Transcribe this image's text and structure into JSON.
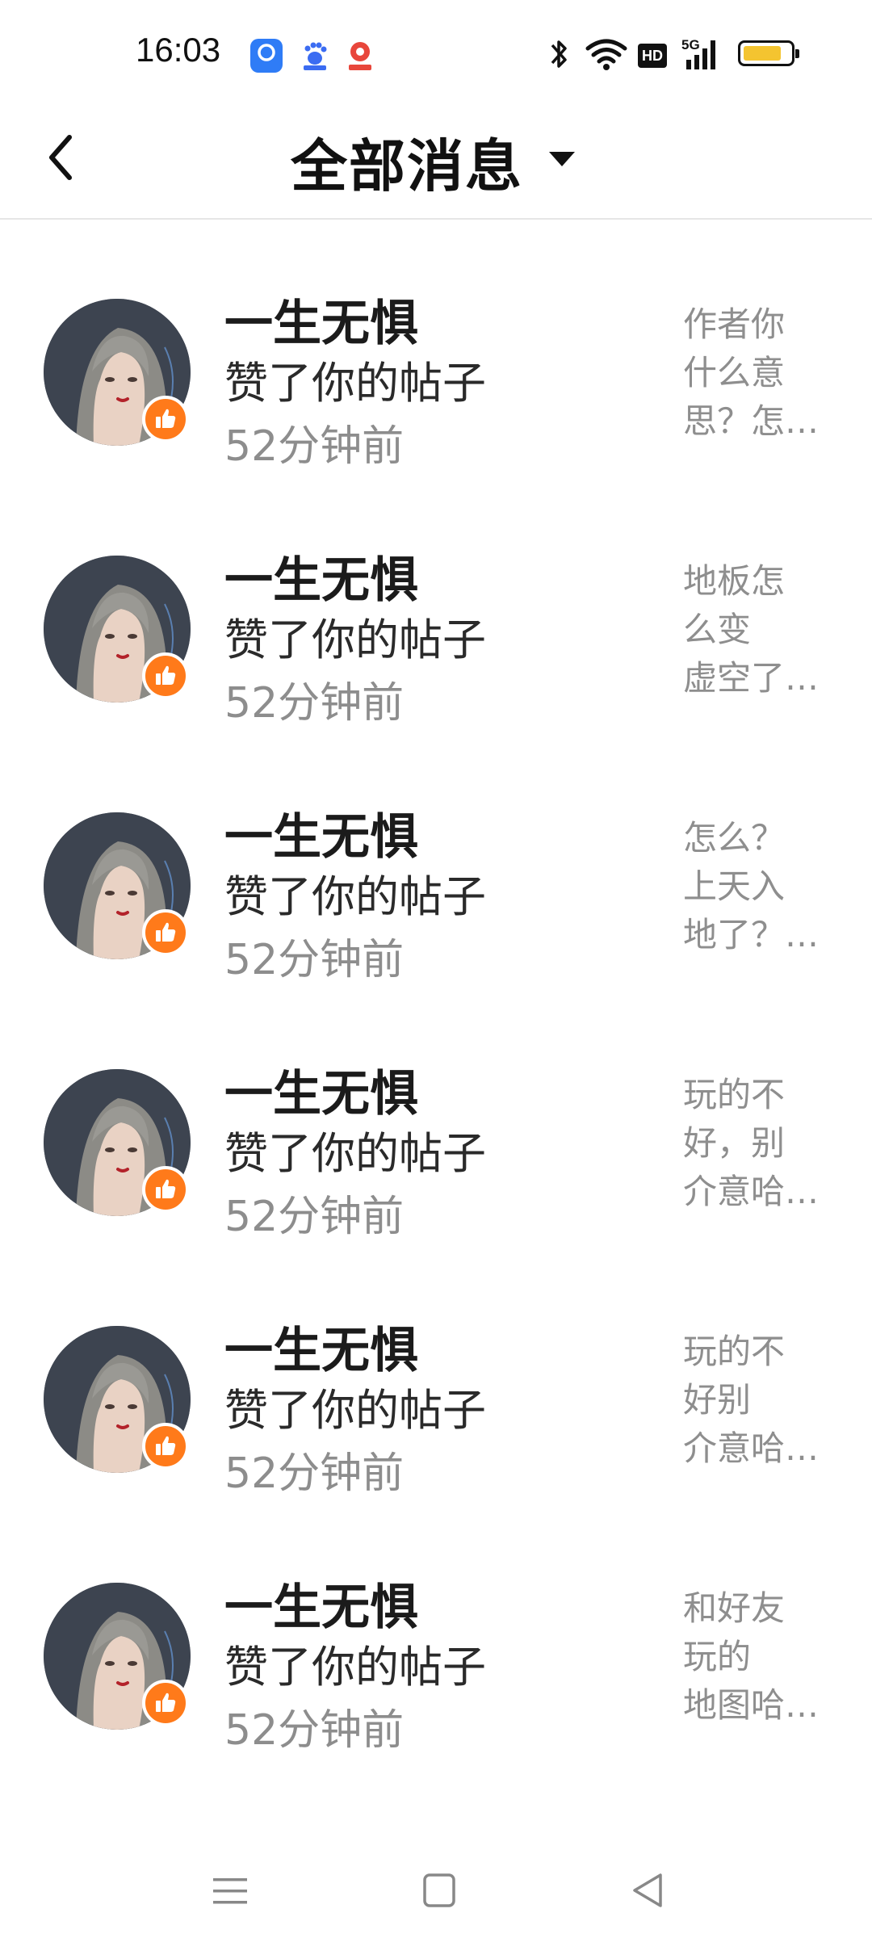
{
  "status_bar": {
    "time": "16:03",
    "apps": [
      {
        "icon": "app-icon-1",
        "label": "",
        "color": "#2f7cf6"
      },
      {
        "icon": "baidu-icon",
        "label": "",
        "color": "#3b6cf2"
      },
      {
        "icon": "app-icon-3",
        "label": "",
        "color": "#e8463b"
      }
    ],
    "indicators": [
      "bluetooth-icon",
      "wifi-icon",
      "hd-icon",
      "5g-signal-icon",
      "battery-icon"
    ],
    "hd_label": "HD",
    "network_label": "5G",
    "battery_color": "#f4c430"
  },
  "header": {
    "title": "全部消息",
    "back_icon": "back-arrow-icon",
    "dropdown_icon": "caret-down-icon"
  },
  "messages": [
    {
      "name": "一生无惧",
      "action": "赞了你的帖子",
      "time": "52分钟前",
      "preview": [
        "作者你",
        "什么意",
        "思？怎…"
      ]
    },
    {
      "name": "一生无惧",
      "action": "赞了你的帖子",
      "time": "52分钟前",
      "preview": [
        "地板怎",
        "么变",
        "虚空了…"
      ]
    },
    {
      "name": "一生无惧",
      "action": "赞了你的帖子",
      "time": "52分钟前",
      "preview": [
        "怎么？",
        "上天入",
        "地了？…"
      ]
    },
    {
      "name": "一生无惧",
      "action": "赞了你的帖子",
      "time": "52分钟前",
      "preview": [
        "玩的不",
        "好，别",
        "介意哈…"
      ]
    },
    {
      "name": "一生无惧",
      "action": "赞了你的帖子",
      "time": "52分钟前",
      "preview": [
        "玩的不",
        "好别",
        "介意哈…"
      ]
    },
    {
      "name": "一生无惧",
      "action": "赞了你的帖子",
      "time": "52分钟前",
      "preview": [
        "和好友",
        "玩的",
        "地图哈…"
      ]
    }
  ],
  "colors": {
    "like_badge": "#ff7a1a",
    "avatar_bg": "#3d4450"
  },
  "nav_bar": {
    "icons": [
      "menu-icon",
      "home-square-icon",
      "back-triangle-icon"
    ]
  }
}
